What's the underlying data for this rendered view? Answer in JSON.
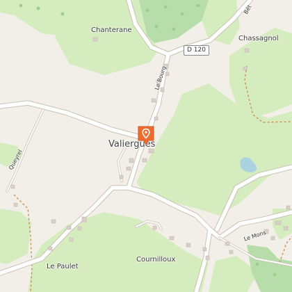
{
  "map": {
    "places": {
      "chanterane": "Chanterane",
      "chassagnol": "Chassagnol",
      "valiergues": "Valiergues",
      "le_paulet": "Le Paulet",
      "cournilloux": "Cournilloux"
    },
    "roads": {
      "d120": "D 120",
      "le_bourg": "Le Bourg",
      "queyrel": "Queyrel",
      "le_mons": "Le Mons",
      "bet": "Bét"
    },
    "marker": {
      "icon": "location-pin-icon",
      "color": "#ef6c2f"
    },
    "colors": {
      "background": "#f2efe9",
      "meadow": "#d5ecbf",
      "forest": "#b6ddaa",
      "road": "#ffffff",
      "water": "#aad3df",
      "trail": "#c8894a"
    }
  }
}
